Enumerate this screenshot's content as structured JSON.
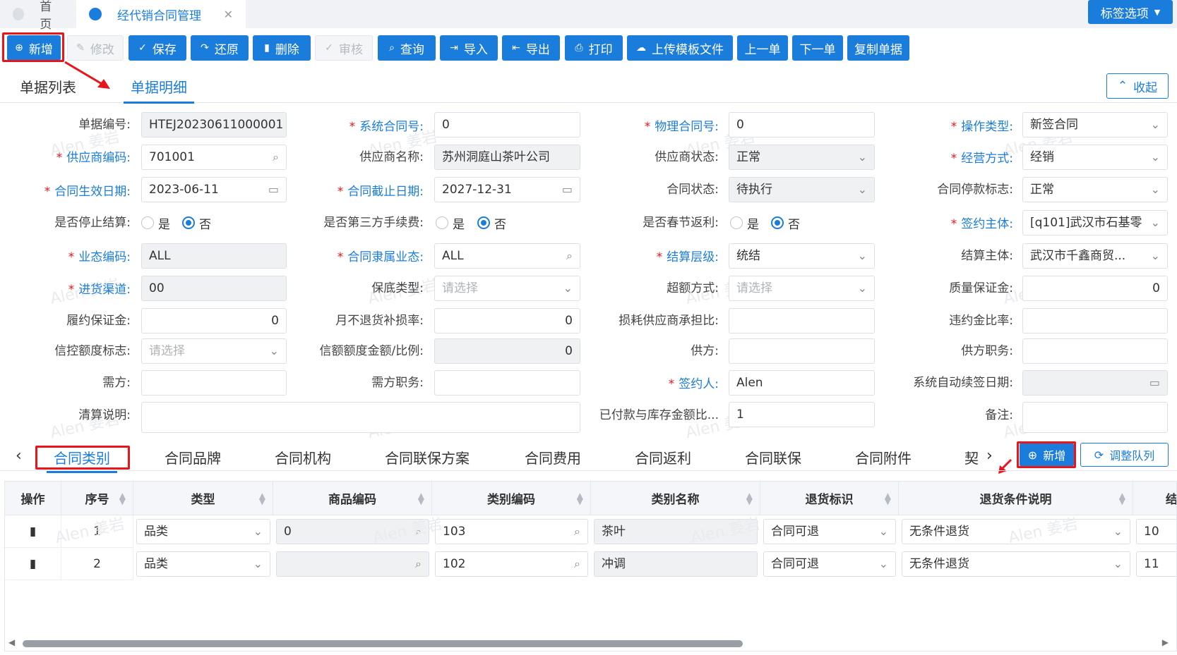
{
  "top_tabs": [
    {
      "label": "首页"
    },
    {
      "label": "经代销合同管理"
    }
  ],
  "tag_options": "标签选项",
  "toolbar": {
    "buttons": [
      {
        "label": "新增",
        "icon": "plus-circle-icon"
      },
      {
        "label": "修改",
        "icon": "edit-icon"
      },
      {
        "label": "保存",
        "icon": "check-icon"
      },
      {
        "label": "还原",
        "icon": "undo-icon"
      },
      {
        "label": "删除",
        "icon": "trash-icon"
      },
      {
        "label": "审核",
        "icon": "check-icon"
      },
      {
        "label": "查询",
        "icon": "search-icon"
      },
      {
        "label": "导入",
        "icon": "import-icon"
      },
      {
        "label": "导出",
        "icon": "export-icon"
      },
      {
        "label": "打印",
        "icon": "print-icon"
      },
      {
        "label": "上传模板文件",
        "icon": "cloud-upload-icon"
      },
      {
        "label": "上一单",
        "icon": ""
      },
      {
        "label": "下一单",
        "icon": ""
      },
      {
        "label": "复制单据",
        "icon": ""
      }
    ]
  },
  "sub_tabs": [
    "单据列表",
    "单据明细"
  ],
  "collapse_label": "收起",
  "form": {
    "fields": [
      {
        "label": "单据编号:",
        "value": "HTEJ20230611000001",
        "required": false
      },
      {
        "label": "系统合同号:",
        "value": "0",
        "required": true
      },
      {
        "label": "物理合同号:",
        "value": "0",
        "required": true
      },
      {
        "label": "操作类型:",
        "value": "新签合同",
        "required": true
      },
      {
        "label": "供应商编码:",
        "value": "701001",
        "required": true
      },
      {
        "label": "供应商名称:",
        "value": "苏州洞庭山茶叶公司",
        "required": false
      },
      {
        "label": "供应商状态:",
        "value": "正常",
        "required": false
      },
      {
        "label": "经营方式:",
        "value": "经销",
        "required": true
      },
      {
        "label": "合同生效日期:",
        "value": "2023-06-11",
        "required": true
      },
      {
        "label": "合同截止日期:",
        "value": "2027-12-31",
        "required": true
      },
      {
        "label": "合同状态:",
        "value": "待执行",
        "required": false
      },
      {
        "label": "合同停款标志:",
        "value": "正常",
        "required": false
      },
      {
        "label": "是否停止结算:",
        "value": "",
        "required": false
      },
      {
        "label": "是否第三方手续费:",
        "value": "",
        "required": false
      },
      {
        "label": "是否春节返利:",
        "value": "",
        "required": false
      },
      {
        "label": "签约主体:",
        "value": "[q101]武汉市石基零",
        "required": true
      },
      {
        "label": "业态编码:",
        "value": "ALL",
        "required": true
      },
      {
        "label": "合同隶属业态:",
        "value": "ALL",
        "required": true
      },
      {
        "label": "结算层级:",
        "value": "统结",
        "required": true
      },
      {
        "label": "结算主体:",
        "value": "武汉市千鑫商贸...",
        "required": false
      },
      {
        "label": "进货渠道:",
        "value": "00",
        "required": true
      },
      {
        "label": "保底类型:",
        "value": "请选择",
        "required": false
      },
      {
        "label": "超额方式:",
        "value": "请选择",
        "required": false
      },
      {
        "label": "质量保证金:",
        "value": "0",
        "required": false
      },
      {
        "label": "履约保证金:",
        "value": "0",
        "required": false
      },
      {
        "label": "月不退货补损率:",
        "value": "0",
        "required": false
      },
      {
        "label": "损耗供应商承担比:",
        "value": "",
        "required": false
      },
      {
        "label": "违约金比率:",
        "value": "",
        "required": false
      },
      {
        "label": "信控额度标志:",
        "value": "请选择",
        "required": false
      },
      {
        "label": "信额额度金额/比例:",
        "value": "0",
        "required": false
      },
      {
        "label": "供方:",
        "value": "",
        "required": false
      },
      {
        "label": "供方职务:",
        "value": "",
        "required": false
      },
      {
        "label": "需方:",
        "value": "",
        "required": false
      },
      {
        "label": "需方职务:",
        "value": "",
        "required": false
      },
      {
        "label": "签约人:",
        "value": "Alen",
        "required": true
      },
      {
        "label": "系统自动续签日期:",
        "value": "",
        "required": false
      },
      {
        "label": "清算说明:",
        "value": "",
        "required": false
      },
      {
        "label": "已付款与库存金额比...",
        "value": "1",
        "required": false
      },
      {
        "label": "备注:",
        "value": "",
        "required": false
      }
    ],
    "radio_yes": "是",
    "radio_no": "否"
  },
  "detail_tabs": [
    "合同类别",
    "合同品牌",
    "合同机构",
    "合同联保方案",
    "合同费用",
    "合同返利",
    "合同联保",
    "合同附件",
    "契"
  ],
  "detail_add": "新增",
  "detail_adjust": "调整队列",
  "table": {
    "columns": [
      "操作",
      "序号",
      "类型",
      "商品编码",
      "类别编码",
      "类别名称",
      "退货标识",
      "退货条件说明",
      "结"
    ],
    "rows": [
      {
        "seq": "1",
        "type": "品类",
        "goods_code": "0",
        "cat_code": "103",
        "cat_name": "茶叶",
        "return_flag": "合同可退",
        "return_desc": "无条件退货",
        "extra": "10"
      },
      {
        "seq": "2",
        "type": "品类",
        "goods_code": "",
        "cat_code": "102",
        "cat_name": "冲调",
        "return_flag": "合同可退",
        "return_desc": "无条件退货",
        "extra": "11"
      }
    ]
  },
  "watermark": "Alen 姜岩",
  "colors": {
    "primary": "#1b7ddb",
    "highlight": "#e8161b"
  }
}
